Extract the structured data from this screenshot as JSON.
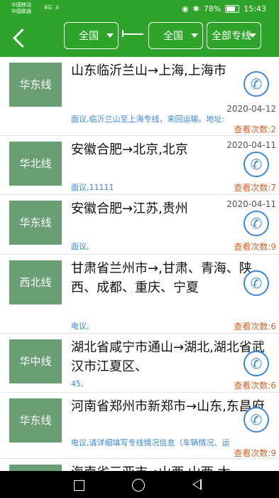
{
  "status": {
    "carrier1": "中国移动",
    "carrier2": "中国联通",
    "signal": "4G .ıl",
    "hd": "HD",
    "battery": "78%",
    "time": "15:43"
  },
  "toolbar": {
    "from": "全国",
    "to": "全国",
    "line_filter": "全部专线"
  },
  "items": [
    {
      "badge": "华东线",
      "route": "山东临沂兰山→上海,上海市",
      "date": "2020-04-12",
      "desc": "面议,临沂兰山至上海专线，来回运输。地址:",
      "views": "查看次数:2"
    },
    {
      "badge": "华北线",
      "route": "安徽合肥→北京,北京",
      "date": "2020-04-11",
      "desc": "面议,11111",
      "views": "查看次数:7"
    },
    {
      "badge": "华东线",
      "route": "安徽合肥→江苏,贵州",
      "date": "2020-04-11",
      "desc": "面议,",
      "views": "查看次数:9"
    },
    {
      "badge": "西北线",
      "route": "甘肃省兰州市→,甘肃、青海、陕西、成都、重庆、宁夏",
      "date": "",
      "desc": "电议,",
      "views": "查看次数:6"
    },
    {
      "badge": "华中线",
      "route": "湖北省咸宁市通山→湖北,湖北省武汉市江夏区、",
      "date": "",
      "desc": "45,",
      "views": "查看次数:6"
    },
    {
      "badge": "华东线",
      "route": "河南省郑州市新郑市→山东,东昌府",
      "date": "",
      "desc": "电议,请详细填写专线情况信息（车辆情况、运",
      "views": "查看次数:9"
    },
    {
      "badge": "",
      "route": "海南省三亚市→山西,山西,太",
      "date": "",
      "desc": "",
      "views": ""
    }
  ]
}
